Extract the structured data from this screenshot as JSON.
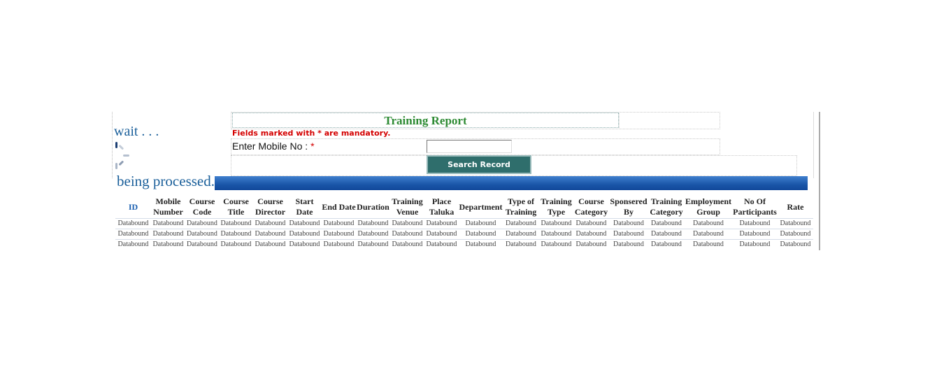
{
  "loading": {
    "wait_text": "wait . . .",
    "processing_text": "being processed."
  },
  "form": {
    "title": "Training Report",
    "mandatory_note": "Fields marked with * are mandatory.",
    "mobile_label": "Enter Mobile No :",
    "required_star": "*",
    "mobile_value": "",
    "search_button": "Search Record"
  },
  "colors": {
    "title": "#2e8b34",
    "mandatory": "#d40000",
    "button": "#2f6e6c",
    "bar": "#1a56a8",
    "loading_text": "#1a5f9a"
  },
  "table": {
    "headers": [
      "ID",
      "Mobile Number",
      "Course Code",
      "Course Title",
      "Course Director",
      "Start Date",
      "End Date",
      "Duration",
      "Training Venue",
      "Place Taluka",
      "Department",
      "Type of Training",
      "Training Type",
      "Course Category",
      "Sponsered By",
      "Training Category",
      "Employment Group",
      "No Of Participants",
      "Rate"
    ],
    "rows": [
      [
        "Databound",
        "Databound",
        "Databound",
        "Databound",
        "Databound",
        "Databound",
        "Databound",
        "Databound",
        "Databound",
        "Databound",
        "Databound",
        "Databound",
        "Databound",
        "Databound",
        "Databound",
        "Databound",
        "Databound",
        "Databound",
        "Databound"
      ],
      [
        "Databound",
        "Databound",
        "Databound",
        "Databound",
        "Databound",
        "Databound",
        "Databound",
        "Databound",
        "Databound",
        "Databound",
        "Databound",
        "Databound",
        "Databound",
        "Databound",
        "Databound",
        "Databound",
        "Databound",
        "Databound",
        "Databound"
      ],
      [
        "Databound",
        "Databound",
        "Databound",
        "Databound",
        "Databound",
        "Databound",
        "Databound",
        "Databound",
        "Databound",
        "Databound",
        "Databound",
        "Databound",
        "Databound",
        "Databound",
        "Databound",
        "Databound",
        "Databound",
        "Databound",
        "Databound"
      ]
    ]
  }
}
